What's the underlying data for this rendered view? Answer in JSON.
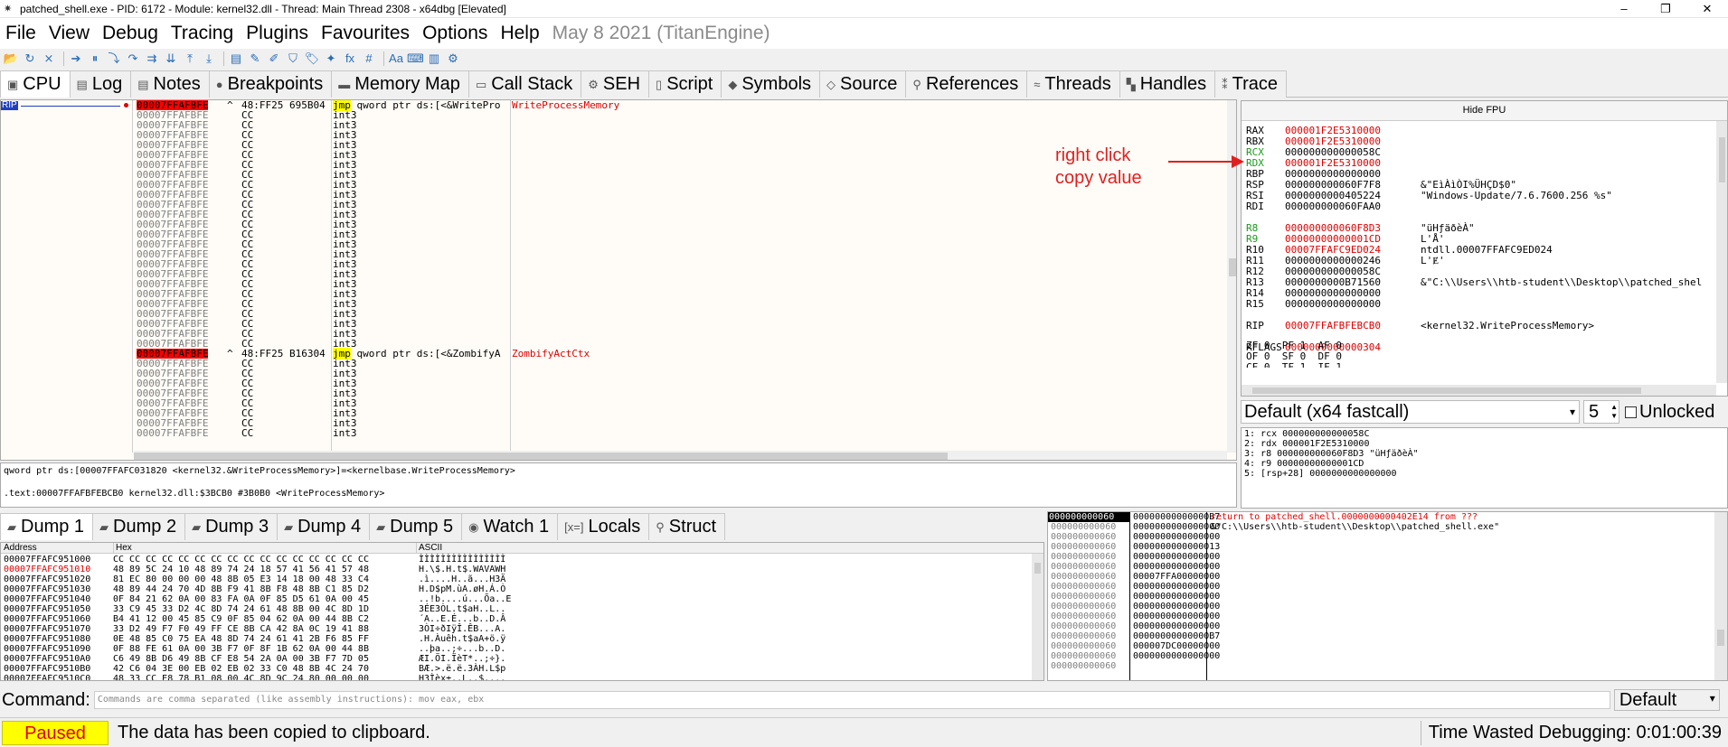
{
  "window": {
    "title": "patched_shell.exe - PID: 6172 - Module: kernel32.dll - Thread: Main Thread 2308 - x64dbg [Elevated]",
    "controls": [
      "‒",
      "❐",
      "✕"
    ]
  },
  "menu": {
    "items": [
      "File",
      "View",
      "Debug",
      "Tracing",
      "Plugins",
      "Favourites",
      "Options",
      "Help"
    ],
    "date": "May 8 2021 (TitanEngine)"
  },
  "toolbar": {
    "icons": [
      "open-icon",
      "restart-icon",
      "close-icon",
      "run-icon",
      "pause-icon",
      "step-into-icon",
      "step-over-icon",
      "trace-into-icon",
      "trace-over-icon",
      "execute-till-return-icon",
      "execute-till-user-code-icon",
      "scylla-icon",
      "comment-icon",
      "label-icon",
      "bookmark-icon",
      "function-icon",
      "highlight-icon",
      "fx-icon",
      "hash-icon",
      "strings-icon",
      "patch-icon",
      "memory-icon",
      "settings-icon"
    ],
    "glyphs": [
      "📂",
      "↻",
      "⨯",
      "➔",
      "⏸",
      "⤵",
      "↷",
      "⇉",
      "⇊",
      "⤒",
      "⤓",
      "▤",
      "✎",
      "✐",
      "⛉",
      "🏷",
      "✦",
      "fx",
      "#",
      "Aa",
      "⌨",
      "▥",
      "⚙"
    ]
  },
  "tabs": [
    {
      "label": "CPU",
      "icon": "▣"
    },
    {
      "label": "Log",
      "icon": "▤"
    },
    {
      "label": "Notes",
      "icon": "▤"
    },
    {
      "label": "Breakpoints",
      "icon": "●"
    },
    {
      "label": "Memory Map",
      "icon": "▬"
    },
    {
      "label": "Call Stack",
      "icon": "▭"
    },
    {
      "label": "SEH",
      "icon": "⚙"
    },
    {
      "label": "Script",
      "icon": "▯"
    },
    {
      "label": "Symbols",
      "icon": "◆"
    },
    {
      "label": "Source",
      "icon": "◇"
    },
    {
      "label": "References",
      "icon": "⚲"
    },
    {
      "label": "Threads",
      "icon": "≈"
    },
    {
      "label": "Handles",
      "icon": "▚"
    },
    {
      "label": "Trace",
      "icon": "⁑"
    }
  ],
  "cpu": {
    "rip_label": "RIP",
    "addr_prefix": "00007FFAFBFE",
    "rows": [
      {
        "addr": "00007FFAFBFE",
        "flag": "^",
        "bytes": "48:FF25 695B04",
        "mn": "jmp",
        "ops": "qword ptr ds:[<&WritePro",
        "cmt": "WriteProcessMemory",
        "kind": "jmp"
      },
      {
        "kind": "cc"
      },
      {
        "kind": "cc"
      },
      {
        "kind": "cc"
      },
      {
        "kind": "cc"
      },
      {
        "kind": "cc"
      },
      {
        "kind": "cc"
      },
      {
        "kind": "cc"
      },
      {
        "kind": "cc"
      },
      {
        "kind": "cc"
      },
      {
        "kind": "cc"
      },
      {
        "kind": "cc"
      },
      {
        "kind": "cc"
      },
      {
        "kind": "cc"
      },
      {
        "kind": "cc"
      },
      {
        "kind": "cc"
      },
      {
        "kind": "cc"
      },
      {
        "kind": "cc"
      },
      {
        "kind": "cc"
      },
      {
        "kind": "cc"
      },
      {
        "kind": "cc"
      },
      {
        "kind": "cc"
      },
      {
        "kind": "cc"
      },
      {
        "kind": "cc"
      },
      {
        "kind": "cc"
      },
      {
        "addr": "00007FFAFBFE",
        "flag": "^",
        "bytes": "48:FF25 B16304",
        "mn": "jmp",
        "ops": "qword ptr ds:[<&ZombifyA",
        "cmt": "ZombifyActCtx",
        "kind": "jmp"
      },
      {
        "kind": "cc"
      },
      {
        "kind": "cc"
      },
      {
        "kind": "cc"
      },
      {
        "kind": "cc"
      },
      {
        "kind": "cc"
      },
      {
        "kind": "cc"
      },
      {
        "kind": "cc"
      },
      {
        "kind": "cc"
      }
    ],
    "cc_bytes": "CC",
    "cc_mn": "int3"
  },
  "info": {
    "line1": "qword ptr ds:[00007FFAFC031820 <kernel32.&WriteProcessMemory>]=<kernelbase.WriteProcessMemory>",
    "line2": ".text:00007FFAFBFEBCB0 kernel32.dll:$3BCB0 #3B0B0 <WriteProcessMemory>"
  },
  "regs": {
    "hide_fpu": "Hide FPU",
    "list": [
      {
        "n": "RAX",
        "v": "000001F2E5310000",
        "c": "",
        "red": true
      },
      {
        "n": "RBX",
        "v": "000001F2E5310000",
        "c": "",
        "red": true
      },
      {
        "n": "RCX",
        "v": "000000000000058C",
        "c": "",
        "green": true
      },
      {
        "n": "RDX",
        "v": "000001F2E5310000",
        "c": "",
        "green": true,
        "red": true
      },
      {
        "n": "RBP",
        "v": "0000000000000000",
        "c": ""
      },
      {
        "n": "RSP",
        "v": "000000000060F7F8",
        "c": "&\"EìÀìÒI%ÜHÇD$0\""
      },
      {
        "n": "RSI",
        "v": "0000000000405224",
        "c": "\"Windows-Update/7.6.7600.256 %s\""
      },
      {
        "n": "RDI",
        "v": "000000000060FAA0",
        "c": ""
      },
      {
        "n": "",
        "v": "",
        "c": ""
      },
      {
        "n": "R8",
        "v": "000000000060F8D3",
        "c": "\"üHƒäðèÀ\"",
        "green": true,
        "red": true
      },
      {
        "n": "R9",
        "v": "00000000000001CD",
        "c": "L'Å'",
        "green": true,
        "red": true
      },
      {
        "n": "R10",
        "v": "00007FFAFC9ED024",
        "c": "ntdll.00007FFAFC9ED024",
        "red": true
      },
      {
        "n": "R11",
        "v": "0000000000000246",
        "c": "L'Ɇ'"
      },
      {
        "n": "R12",
        "v": "000000000000058C",
        "c": ""
      },
      {
        "n": "R13",
        "v": "0000000000B71560",
        "c": "&\"C:\\\\Users\\\\htb-student\\\\Desktop\\\\patched_shel"
      },
      {
        "n": "R14",
        "v": "0000000000000000",
        "c": ""
      },
      {
        "n": "R15",
        "v": "0000000000000000",
        "c": ""
      },
      {
        "n": "",
        "v": "",
        "c": ""
      },
      {
        "n": "RIP",
        "v": "00007FFAFBFEBCB0",
        "c": "<kernel32.WriteProcessMemory>",
        "red": true
      },
      {
        "n": "",
        "v": "",
        "c": ""
      },
      {
        "n": "RFLAGS",
        "v": "0000000000000304",
        "c": "",
        "red": true
      }
    ],
    "flags1": "ZF 0  PF 1  AF 0",
    "flags2": "OF 0  SF 0  DF 0",
    "flags3": "CF 0  TF 1  IF 1"
  },
  "annotation": {
    "line1": "right click",
    "line2": "copy value"
  },
  "callconv": {
    "selected": "Default (x64 fastcall)",
    "count": "5",
    "unlocked": "Unlocked"
  },
  "args": [
    "1: rcx 000000000000058C",
    "2: rdx 000001F2E5310000",
    "3: r8 000000000060F8D3 \"üHƒäðèÀ\"",
    "4: r9 00000000000001CD",
    "5: [rsp+28] 0000000000000000"
  ],
  "dump_tabs": [
    {
      "label": "Dump 1",
      "icon": "▰"
    },
    {
      "label": "Dump 2",
      "icon": "▰"
    },
    {
      "label": "Dump 3",
      "icon": "▰"
    },
    {
      "label": "Dump 4",
      "icon": "▰"
    },
    {
      "label": "Dump 5",
      "icon": "▰"
    },
    {
      "label": "Watch 1",
      "icon": "◉"
    },
    {
      "label": "Locals",
      "icon": "[x=]"
    },
    {
      "label": "Struct",
      "icon": "⚲"
    }
  ],
  "dump": {
    "headers": {
      "address": "Address",
      "hex": "Hex",
      "ascii": "ASCII"
    },
    "rows": [
      {
        "a": "00007FFAFC951000",
        "h": "CC CC CC CC CC CC CC CC CC CC CC CC CC CC CC CC",
        "s": "ÌÌÌÌÌÌÌÌÌÌÌÌÌÌÌÌ"
      },
      {
        "a": "00007FFAFC951010",
        "h": "48 89 5C 24 10 48 89 74 24 18 57 41 56 41 57 48",
        "s": "H.\\$.H.t$.WAVAWH"
      },
      {
        "a": "00007FFAFC951020",
        "h": "81 EC 80 00 00 00 48 8B 05 E3 14 18 00 48 33 C4",
        "s": ".ì....H..ã...H3Ä"
      },
      {
        "a": "00007FFAFC951030",
        "h": "48 89 44 24 70 4D 8B F9 41 8B F8 48 8B C1 85 D2",
        "s": "H.D$pM.ùA.øH.Á.Ò"
      },
      {
        "a": "00007FFAFC951040",
        "h": "0F 84 21 62 0A 00 83 FA 0A 0F 85 D5 61 0A 00 45",
        "s": "..!b....ú...Õa..E"
      },
      {
        "a": "00007FFAFC951050",
        "h": "33 C9 45 33 D2 4C 8D 74 24 61 48 8B 00 4C 8D 1D",
        "s": "3ÉE3ÒL.t$aH..L.."
      },
      {
        "a": "00007FFAFC951060",
        "h": "B4 41 12 00 45 85 C9 0F 85 04 62 0A 00 44 8B C2",
        "s": "´A..E.É...b..D.Â"
      },
      {
        "a": "00007FFAFC951070",
        "h": "33 D2 49 F7 F0 49 FF CE 8B CA 42 8A 0C 19 41 88",
        "s": "3ÒI÷ðIÿÎ.ÊB...A."
      },
      {
        "a": "00007FFAFC951080",
        "h": "0E 48 85 C0 75 EA 48 8D 74 24 61 41 2B F6 85 FF",
        "s": ".H.Àuêh.t$aA+ö.ÿ"
      },
      {
        "a": "00007FFAFC951090",
        "h": "0F 88 FE 61 0A 00 3B F7 0F 8F 1B 62 0A 00 44 8B",
        "s": "..þa..;÷...b..D."
      },
      {
        "a": "00007FFAFC9510A0",
        "h": "C6 49 8B D6 49 8B CF E8 54 2A 0A 00 3B F7 7D 05",
        "s": "ÆI.ÖI.ÏèT*..;÷}."
      },
      {
        "a": "00007FFAFC9510B0",
        "h": "42 C6 04 3E 00 EB 02 EB 02 33 C0 48 8B 4C 24 70",
        "s": "BÆ.>.ë.ë.3ÀH.L$p"
      },
      {
        "a": "00007FFAFC9510C0",
        "h": "48 33 CC E8 78 B1 08 00 4C 8D 9C 24 80 00 00 00",
        "s": "H3Ìèx±..L..$...."
      }
    ]
  },
  "stack": {
    "sel": "000000000060",
    "col1": [
      "00000000000000B7",
      "0000000000000000",
      "0000000000000000",
      "0000000000000013",
      "0000000000000000",
      "0000000000000000",
      "00007FFA00000000",
      "0000000000000000",
      "0000000000000000",
      "0000000000000000",
      "0000000000000000",
      "0000000000000000",
      "00000000000000B7",
      "000007DC00000000",
      "0000000000000000"
    ],
    "comment_red": "return to patched_shell.0000000000402E14 from ???",
    "comment2": "&\"C:\\\\Users\\\\htb-student\\\\Desktop\\\\patched_shell.exe\""
  },
  "command": {
    "label": "Command:",
    "placeholder": "Commands are comma separated (like assembly instructions): mov eax, ebx",
    "mode": "Default"
  },
  "status": {
    "state": "Paused",
    "message": "The data has been copied to clipboard.",
    "wasted": "Time Wasted Debugging: 0:01:00:39"
  }
}
